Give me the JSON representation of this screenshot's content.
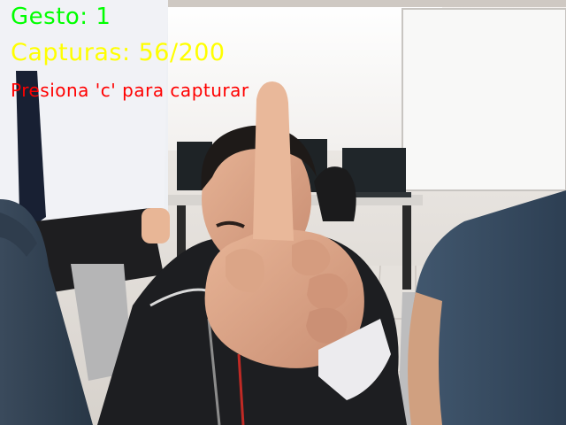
{
  "window": {
    "gesture_label": "Gesto: 1",
    "captures_label": "Capturas: 56/200",
    "instruction_label": "Presiona 'c' para capturar"
  },
  "colors": {
    "gesture_text": "#00ff00",
    "captures_text": "#ffff00",
    "instruction_text": "#ff0000"
  },
  "icons": {
    "gesture_subject": "raised-index-finger-hand"
  }
}
